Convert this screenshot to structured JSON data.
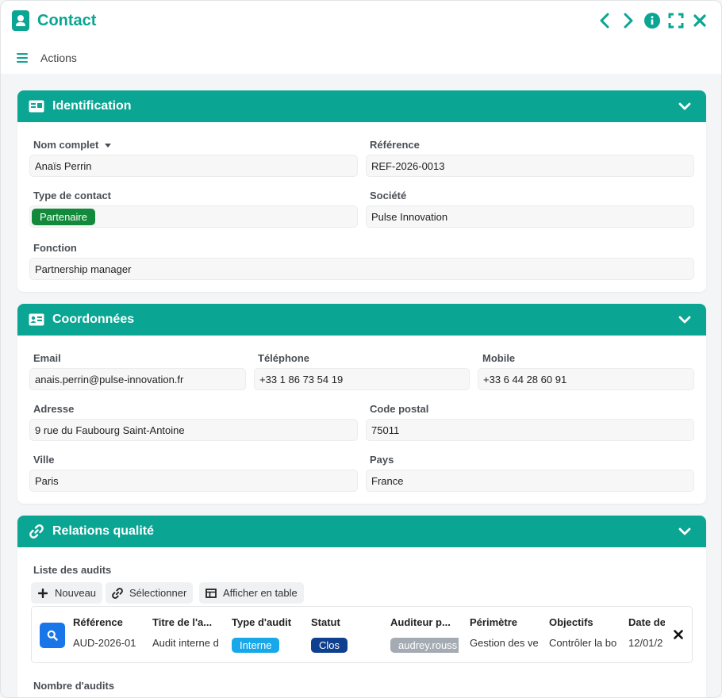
{
  "window": {
    "title": "Contact",
    "actions_label": "Actions",
    "accent": "#0aa593"
  },
  "identification": {
    "title": "Identification",
    "nom_complet": {
      "label": "Nom complet",
      "value": "Anaïs Perrin"
    },
    "reference": {
      "label": "Référence",
      "value": "REF-2026-0013"
    },
    "type_contact": {
      "label": "Type de contact",
      "value": "Partenaire"
    },
    "societe": {
      "label": "Société",
      "value": "Pulse Innovation"
    },
    "fonction": {
      "label": "Fonction",
      "value": "Partnership manager"
    }
  },
  "coordonnees": {
    "title": "Coordonnées",
    "email": {
      "label": "Email",
      "value": "anais.perrin@pulse-innovation.fr"
    },
    "telephone": {
      "label": "Téléphone",
      "value": "+33 1 86 73 54 19"
    },
    "mobile": {
      "label": "Mobile",
      "value": "+33 6 44 28 60 91"
    },
    "adresse": {
      "label": "Adresse",
      "value": "9 rue du Faubourg Saint-Antoine"
    },
    "code_postal": {
      "label": "Code postal",
      "value": "75011"
    },
    "ville": {
      "label": "Ville",
      "value": "Paris"
    },
    "pays": {
      "label": "Pays",
      "value": "France"
    }
  },
  "relations": {
    "title": "Relations qualité",
    "liste_label": "Liste des audits",
    "toolbar": {
      "nouveau": "Nouveau",
      "selectionner": "Sélectionner",
      "afficher_table": "Afficher en table"
    },
    "table": {
      "headers": [
        "Référence",
        "Titre de l'a...",
        "Type d'audit",
        "Statut",
        "Auditeur p...",
        "Périmètre",
        "Objectifs",
        "Date de"
      ],
      "row": {
        "reference": "AUD-2026-01",
        "titre": "Audit interne d",
        "type": "Interne",
        "statut": "Clos",
        "auditeur": "audrey.rouss",
        "perimetre": "Gestion des ve",
        "objectifs": "Contrôler la bo",
        "date": "12/01/2"
      }
    },
    "nombre_label": "Nombre d'audits"
  }
}
